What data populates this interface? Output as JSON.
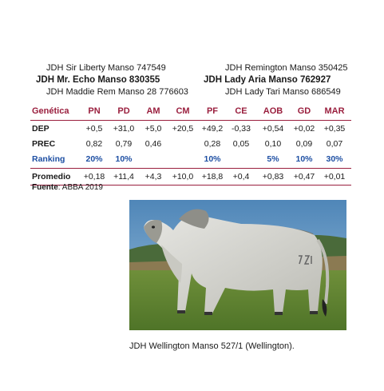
{
  "pedigree": {
    "sire_sire": "JDH Sir Liberty Manso 747549",
    "sire": "JDH Mr. Echo Manso 830355",
    "sire_dam": "JDH Maddie Rem Manso 28 776603",
    "dam_sire": "JDH Remington Manso 350425",
    "dam": "JDH Lady Aria Manso 762927",
    "dam_dam": "JDH Lady Tari Manso 686549"
  },
  "table": {
    "header": [
      "Genética",
      "PN",
      "PD",
      "AM",
      "CM",
      "PF",
      "CE",
      "AOB",
      "GD",
      "MAR"
    ],
    "rows": {
      "dep": [
        "DEP",
        "+0,5",
        "+31,0",
        "+5,0",
        "+20,5",
        "+49,2",
        "-0,33",
        "+0,54",
        "+0,02",
        "+0,35"
      ],
      "prec": [
        "PREC",
        "0,82",
        "0,79",
        "0,46",
        "",
        "0,28",
        "0,05",
        "0,10",
        "0,09",
        "0,07"
      ],
      "ranking": [
        "Ranking",
        "20%",
        "10%",
        "",
        "",
        "10%",
        "",
        "5%",
        "10%",
        "30%"
      ],
      "promedio": [
        "Promedio",
        "+0,18",
        "+11,4",
        "+4,3",
        "+10,0",
        "+18,8",
        "+0,4",
        "+0,83",
        "+0,47",
        "+0,01"
      ]
    }
  },
  "source": {
    "label": "Fuente",
    "text": ": ABBA 2019"
  },
  "caption": "JDH Wellington Manso 527/1 (Wellington)."
}
